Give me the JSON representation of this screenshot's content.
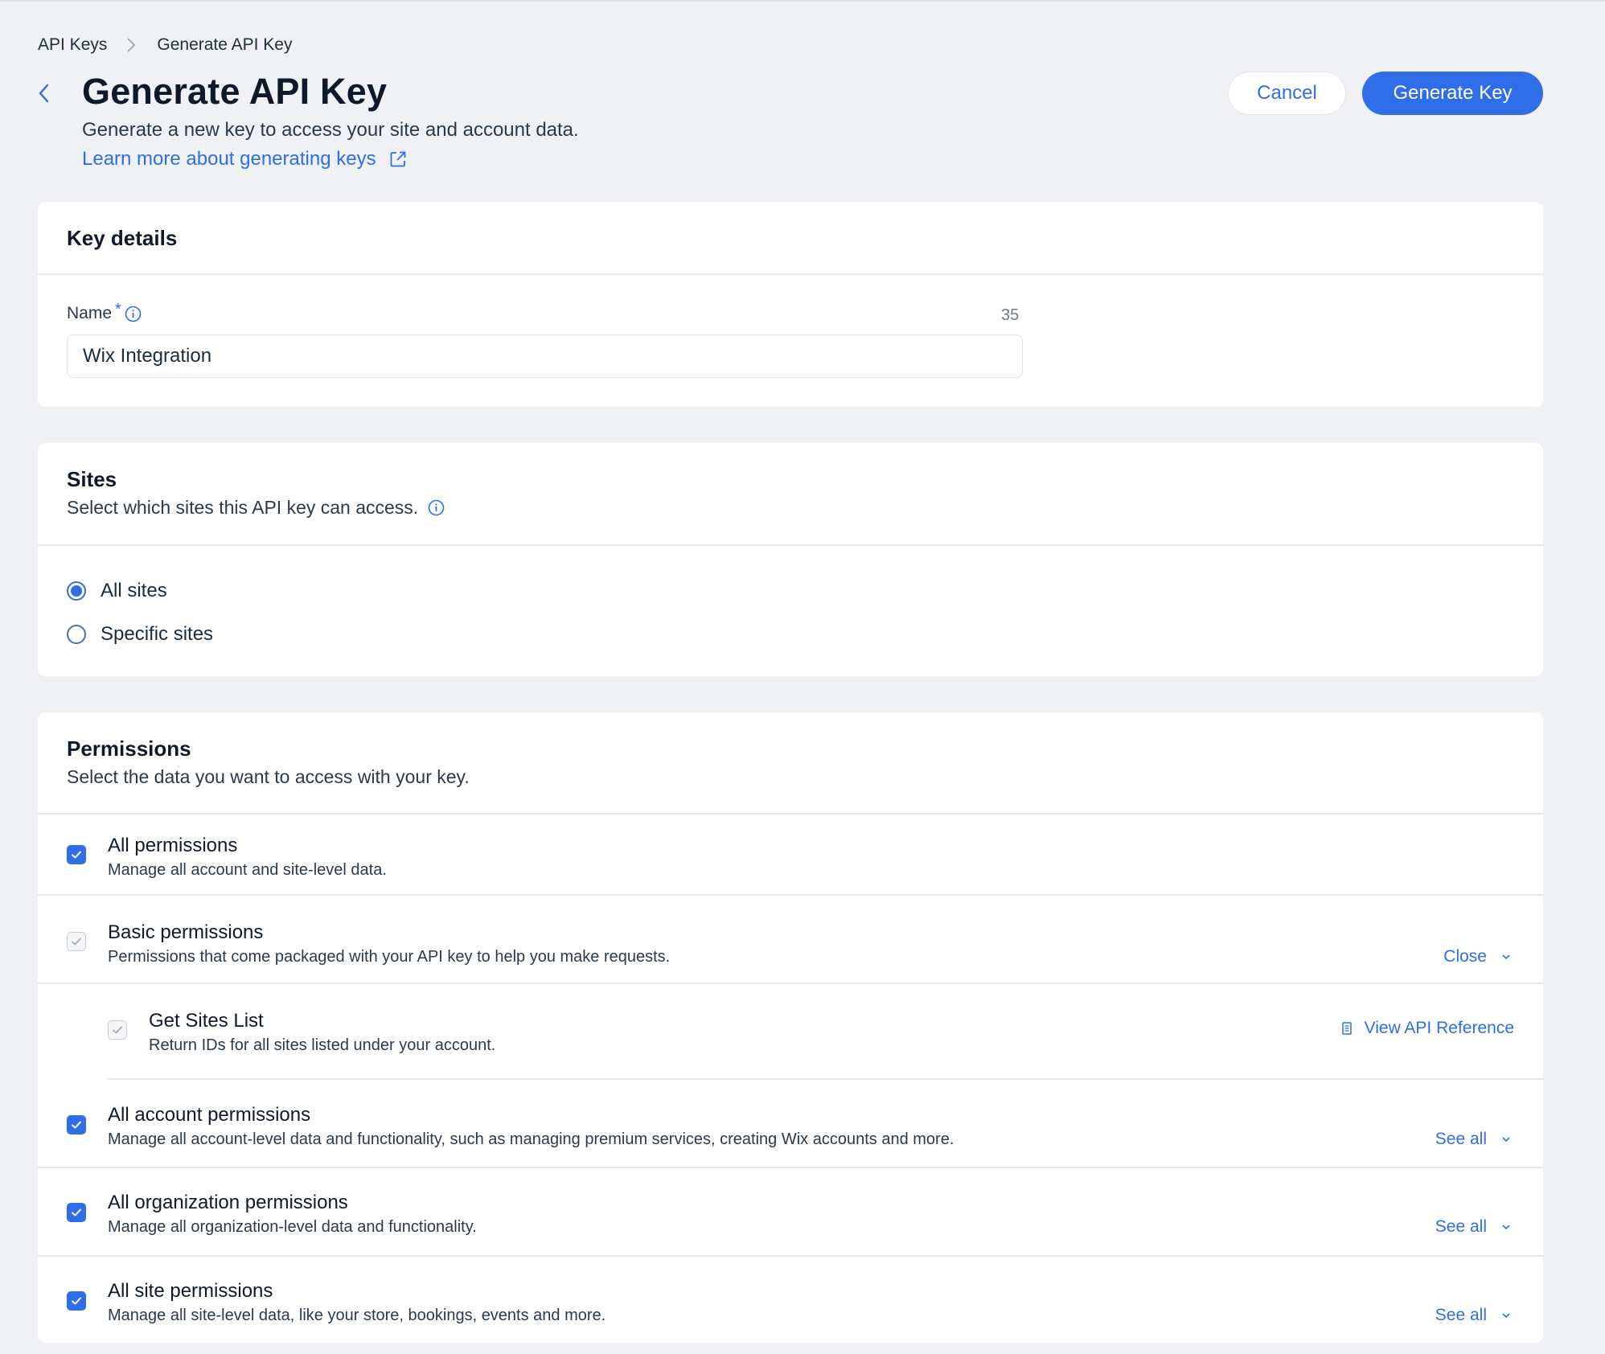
{
  "breadcrumb": {
    "items": [
      "API Keys",
      "Generate API Key"
    ]
  },
  "header": {
    "title": "Generate API Key",
    "subtitle": "Generate a new key to access your site and account data.",
    "learn_more": "Learn more about generating keys",
    "cancel_label": "Cancel",
    "generate_label": "Generate Key"
  },
  "key_details": {
    "title": "Key details",
    "name_label": "Name",
    "required_mark": "*",
    "char_count": "35",
    "name_value": "Wix Integration"
  },
  "sites": {
    "title": "Sites",
    "subtitle": "Select which sites this API key can access.",
    "options": [
      {
        "label": "All sites",
        "selected": true
      },
      {
        "label": "Specific sites",
        "selected": false
      }
    ]
  },
  "permissions": {
    "title": "Permissions",
    "subtitle": "Select the data you want to access with your key.",
    "items": [
      {
        "title": "All permissions",
        "desc": "Manage all account and site-level data.",
        "checked": true,
        "action": ""
      },
      {
        "title": "Basic permissions",
        "desc": "Permissions that come packaged with your API key to help you make requests.",
        "checked": true,
        "disabled": true,
        "action": "Close"
      },
      {
        "title": "Get Sites List",
        "desc": "Return IDs for all sites listed under your account.",
        "checked": true,
        "disabled": true,
        "action": "View API Reference"
      },
      {
        "title": "All account permissions",
        "desc": "Manage all account-level data and functionality, such as managing premium services, creating Wix accounts and more.",
        "checked": true,
        "action": "See all"
      },
      {
        "title": "All organization permissions",
        "desc": "Manage all organization-level data and functionality.",
        "checked": true,
        "action": "See all"
      },
      {
        "title": "All site permissions",
        "desc": "Manage all site-level data, like your store, bookings, events and more.",
        "checked": true,
        "action": "See all"
      }
    ]
  },
  "colors": {
    "accent": "#2f6ee8",
    "background": "#f0f1f5",
    "card": "#ffffff",
    "text": "#0e1a2b"
  }
}
